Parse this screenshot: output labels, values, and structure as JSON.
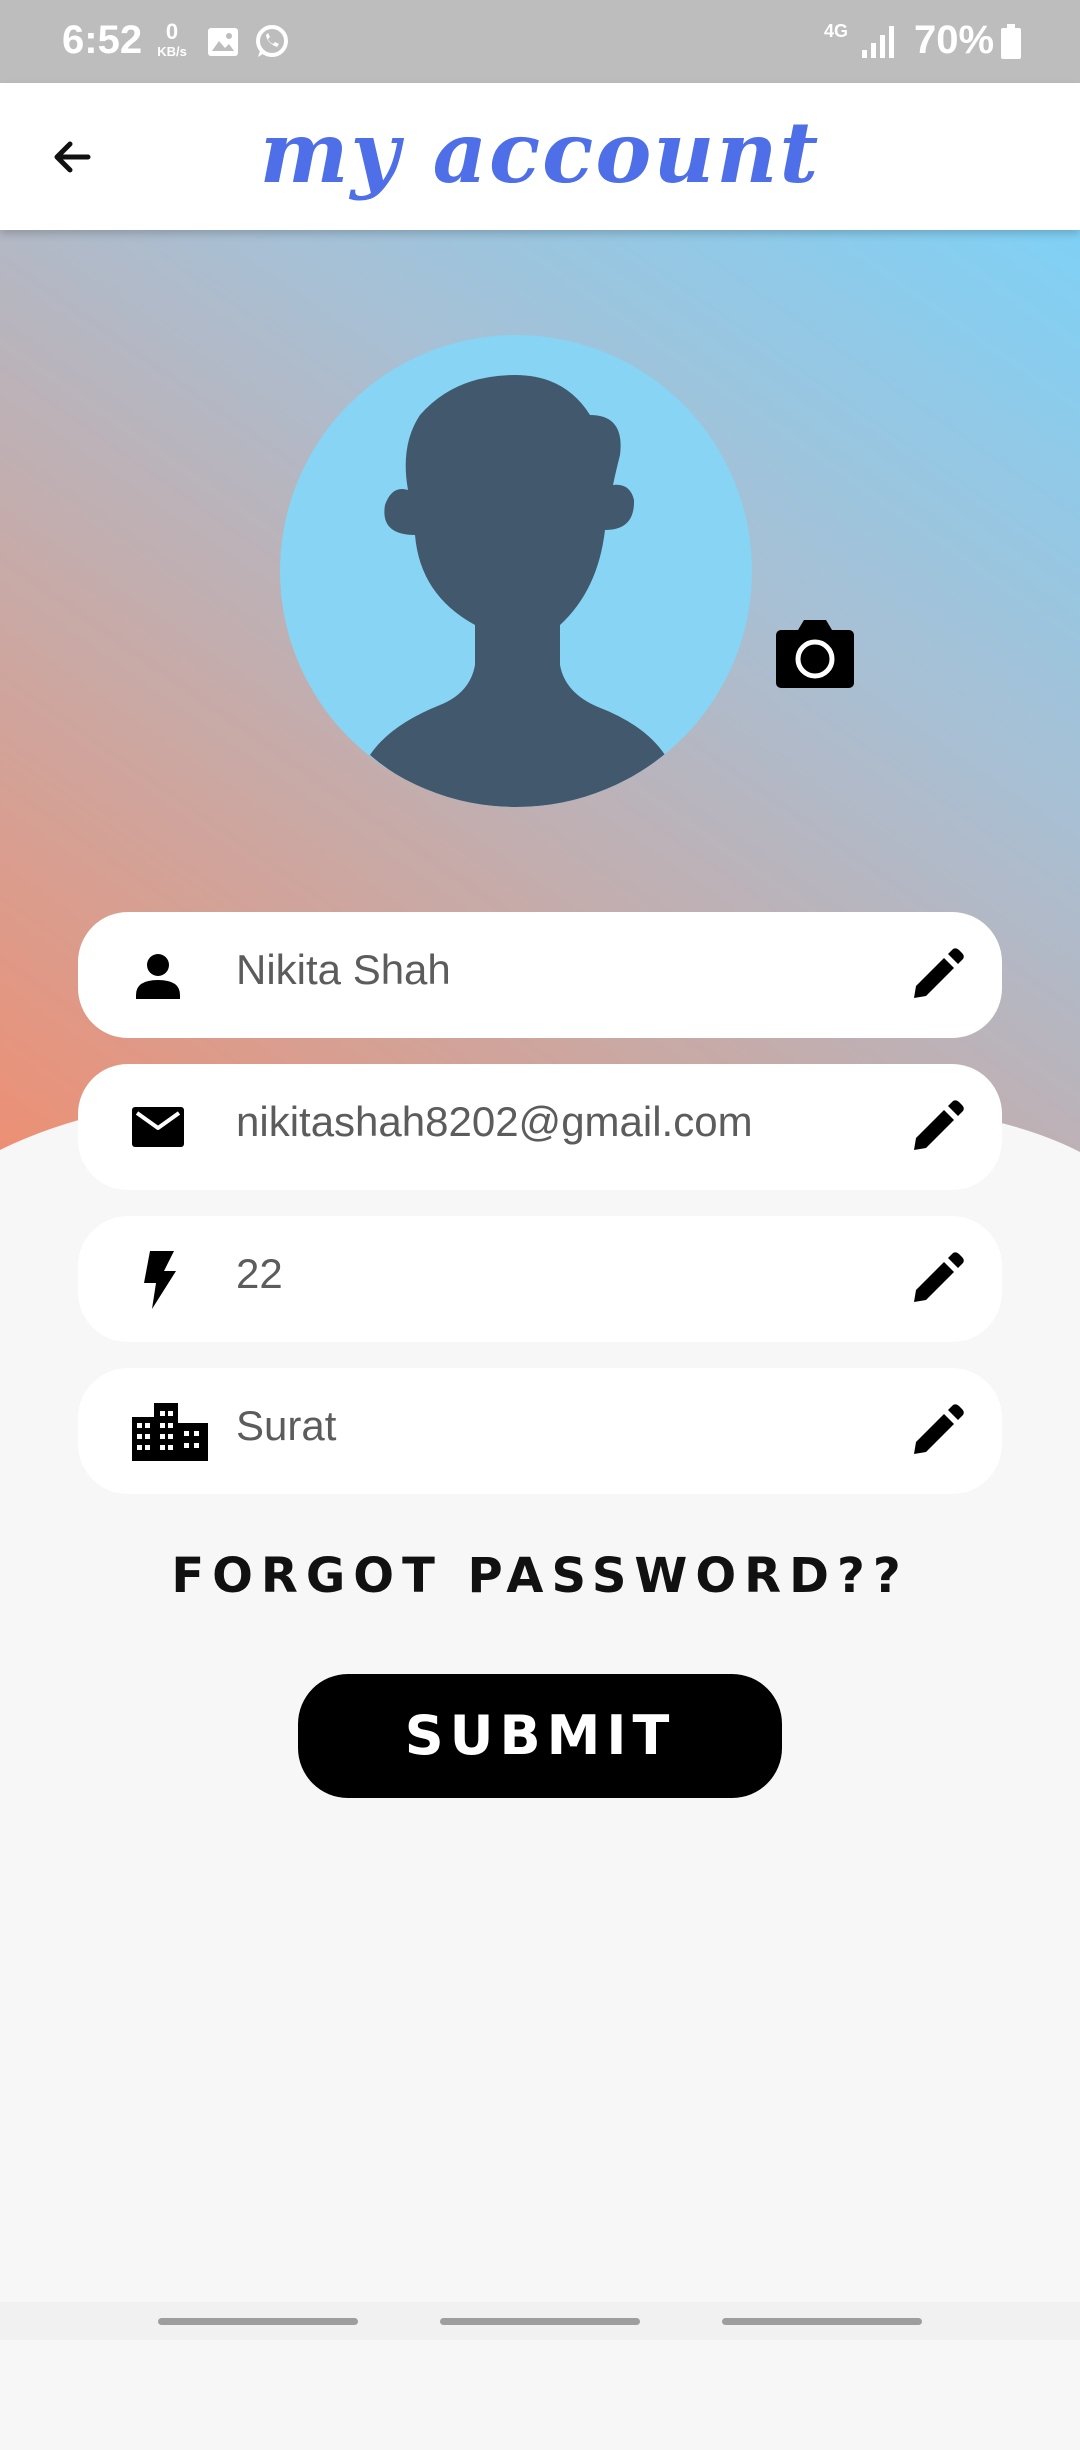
{
  "status_bar": {
    "time": "6:52",
    "net_speed_value": "0",
    "net_speed_unit": "KB/s",
    "network_type": "4G",
    "battery_percent": "70%",
    "icons": [
      "gallery-icon",
      "whatsapp-icon",
      "signal-icon",
      "battery-icon"
    ]
  },
  "app_bar": {
    "title": "my account",
    "back_icon": "arrow-left-icon",
    "title_color": "#4f6fe8"
  },
  "profile": {
    "avatar_icon": "person-silhouette-icon",
    "camera_icon": "camera-icon"
  },
  "fields": [
    {
      "icon": "person-icon",
      "value": "Nikita Shah",
      "action_icon": "pencil-icon"
    },
    {
      "icon": "mail-icon",
      "value": "nikitashah8202@gmail.com",
      "action_icon": "pencil-icon"
    },
    {
      "icon": "bolt-icon",
      "value": "22",
      "action_icon": "pencil-icon"
    },
    {
      "icon": "city-icon",
      "value": "Surat",
      "action_icon": "pencil-icon"
    }
  ],
  "actions": {
    "forgot_password": "FORGOT PASSWORD??",
    "submit": "SUBMIT"
  },
  "colors": {
    "gradient_top_right": "#7fd1f6",
    "gradient_bottom_left": "#ef8e71",
    "avatar_bg": "#87d4f4",
    "silhouette": "#41586d"
  }
}
